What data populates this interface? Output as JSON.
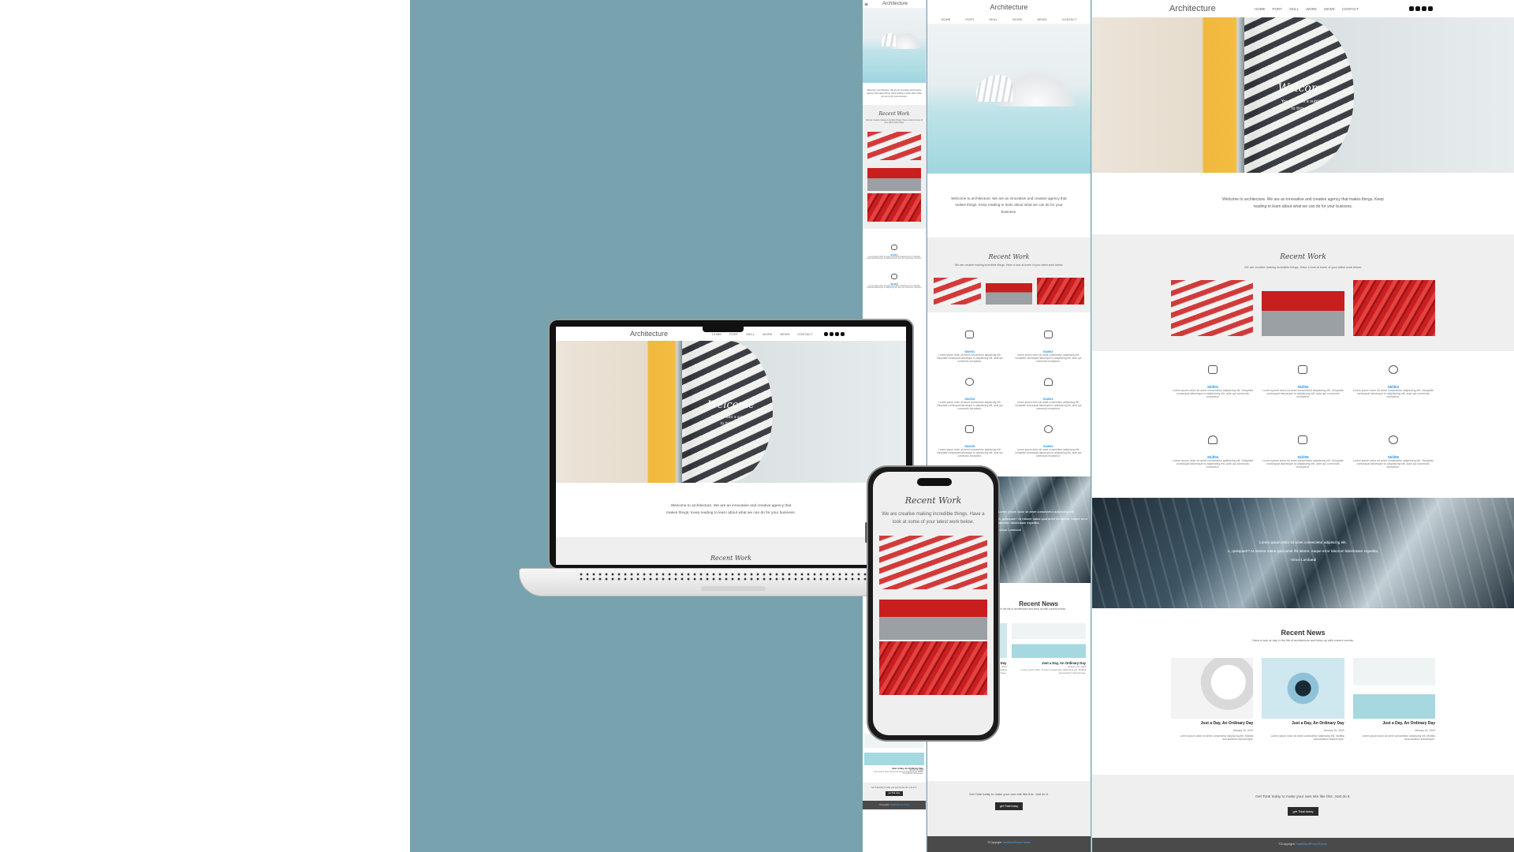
{
  "site": {
    "brand": "Architecture",
    "nav": [
      "HOME",
      "PORT",
      "SKILL",
      "WORK",
      "NEWS",
      "CONTACT"
    ],
    "social_icons": [
      "twitter-icon",
      "facebook-icon",
      "instagram-icon",
      "youtube-icon"
    ],
    "hero_title": "Welcome",
    "hero_sub1": "You can add a subtitle",
    "hero_sub2": "to this page",
    "welcome_text": "Welcome to architecture. We are an innovative and creative agency that makes things. Keep reading to learn about what we can do for your business.",
    "recent_work_title": "Recent Work",
    "recent_work_sub": "We are creative making incredible things. Have a look at some of your latest work below.",
    "skills": [
      {
        "name": "Skill01",
        "icon": "chart-icon"
      },
      {
        "name": "Skill02",
        "icon": "sliders-icon"
      },
      {
        "name": "Skill03",
        "icon": "gear-icon"
      },
      {
        "name": "Skill04",
        "icon": "headphones-icon"
      },
      {
        "name": "Skill05",
        "icon": "tools-icon"
      },
      {
        "name": "Skill06",
        "icon": "support-icon"
      }
    ],
    "skill_desc": "Lorem ipsum dolor sit amet consectetur adipiscing elit. Voluptate consequat laboreque tu adipisicing elit, aute qui commodo excepteur.",
    "quote_1": "Lorem ipsum dolor sit amet consectetur adipiscing elit.",
    "quote_2": "A, quisquam? At ratione natus quia amet illo labore, eaque error laborum laboriosam expedita.",
    "quote_author": "-Vince Lombardi",
    "recent_news_title": "Recent News",
    "recent_news_sub": "Have a look at day in the life of architecture and keep up with current events.",
    "news": [
      {
        "title": "Just a Day, An Ordinary Day",
        "date": "January 16, 2020"
      },
      {
        "title": "Just a Day, An Ordinary Day",
        "date": "January 16, 2020"
      },
      {
        "title": "Just a Day, An Ordinary Day",
        "date": "January 16, 2020"
      }
    ],
    "news_excerpt": "Lorem ipsum dolor sit amet consectetur adipiscing elit. Mollitia accusantium doloremque.",
    "cta_text": "Get Total today to make your own site like this. Just do it.",
    "cta_button": "get Total today",
    "footer_prefix": "©Copyright",
    "footer_link": "TotalWordPressTheme"
  },
  "colors": {
    "background_teal": "#77a2ae",
    "accent_blue": "#2196f3",
    "footer_grey": "#4a4a4a"
  }
}
